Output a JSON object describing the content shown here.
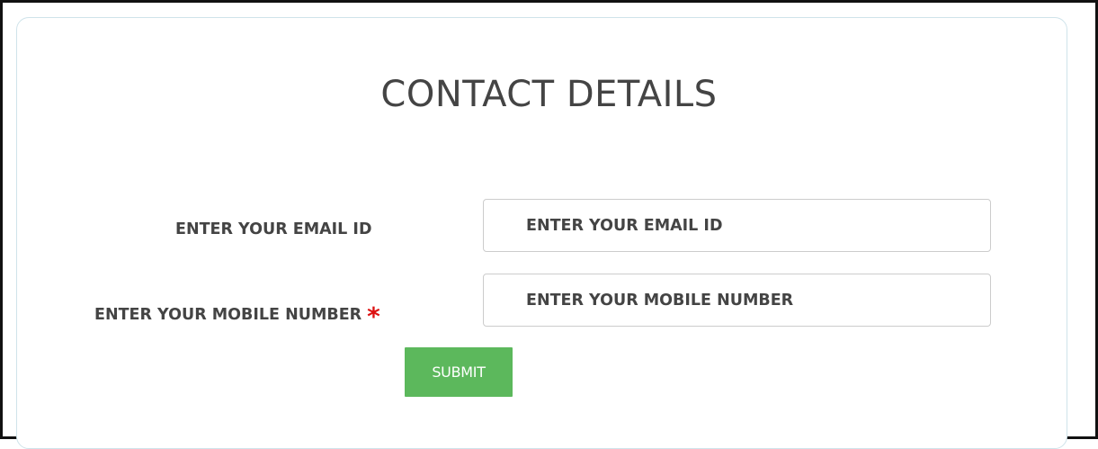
{
  "form": {
    "title": "CONTACT DETAILS",
    "email": {
      "label": "ENTER YOUR EMAIL ID",
      "placeholder": "ENTER YOUR EMAIL ID",
      "value": ""
    },
    "mobile": {
      "label": "ENTER YOUR MOBILE NUMBER",
      "required_mark": "*",
      "placeholder": "ENTER YOUR MOBILE NUMBER",
      "value": ""
    },
    "submit_label": "SUBMIT"
  },
  "colors": {
    "submit_bg": "#5cb85c",
    "required_mark": "#dd1111",
    "text": "#444444",
    "card_border": "#cfe3ea"
  }
}
